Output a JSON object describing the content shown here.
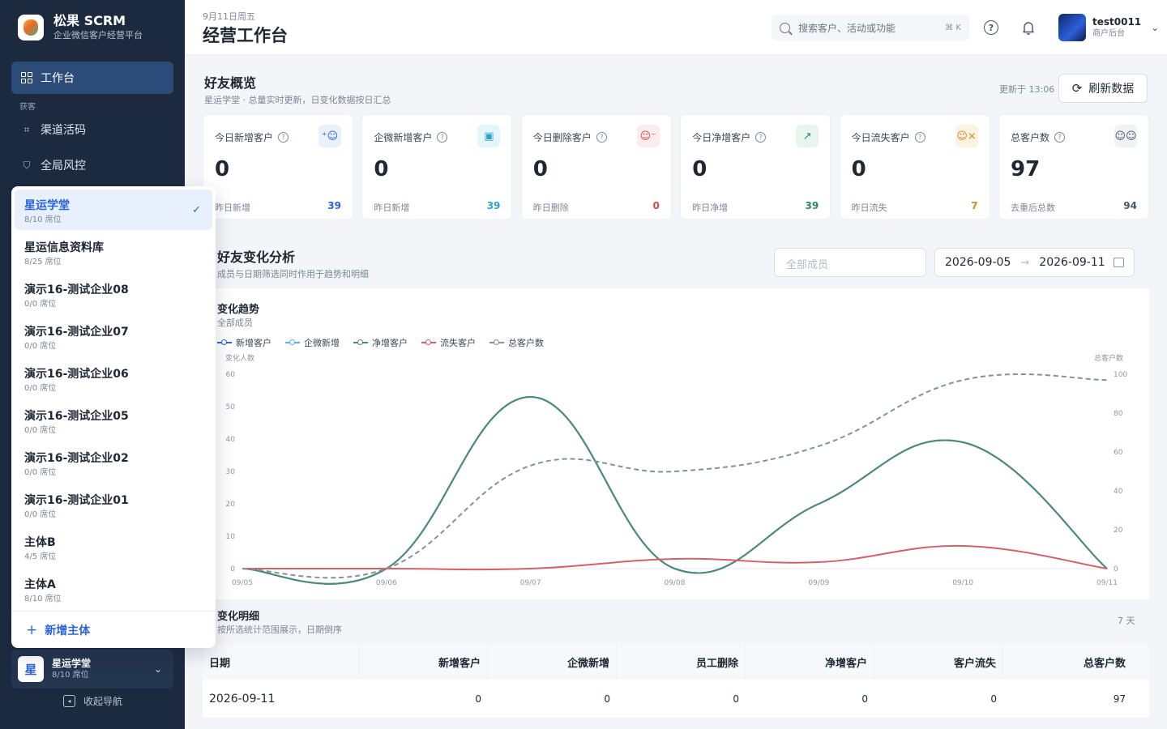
{
  "brand": {
    "title": "松果 SCRM",
    "subtitle": "企业微信客户经营平台"
  },
  "sidebar": {
    "active_item": "工作台",
    "group_label": "获客",
    "items": [
      {
        "label": "渠道活码",
        "icon": "qrcode-icon"
      },
      {
        "label": "全局风控",
        "icon": "shield-icon"
      }
    ],
    "current_org": {
      "avatar": "星",
      "name": "星运学堂",
      "seats": "8/10 席位"
    },
    "collapse_label": "收起导航"
  },
  "org_dropdown": {
    "items": [
      {
        "name": "星运学堂",
        "seats": "8/10 席位",
        "selected": true
      },
      {
        "name": "星运信息资料库",
        "seats": "8/25 席位"
      },
      {
        "name": "演示16-测试企业08",
        "seats": "0/0 席位"
      },
      {
        "name": "演示16-测试企业07",
        "seats": "0/0 席位"
      },
      {
        "name": "演示16-测试企业06",
        "seats": "0/0 席位"
      },
      {
        "name": "演示16-测试企业05",
        "seats": "0/0 席位"
      },
      {
        "name": "演示16-测试企业02",
        "seats": "0/0 席位"
      },
      {
        "name": "演示16-测试企业01",
        "seats": "0/0 席位"
      },
      {
        "name": "主体B",
        "seats": "4/5 席位"
      },
      {
        "name": "主体A",
        "seats": "8/10 席位"
      }
    ],
    "add_label": "新增主体"
  },
  "header": {
    "date": "9月11日周五",
    "title": "经营工作台",
    "search_placeholder": "搜索客户、活动或功能",
    "search_shortcut": "⌘ K",
    "user_name": "test0011",
    "user_role": "商户后台"
  },
  "overview": {
    "title": "好友概览",
    "subtitle": "星运学堂 · 总量实时更新，日变化数据按日汇总",
    "updated": "更新于 13:06",
    "refresh_label": "刷新数据",
    "cards": [
      {
        "label": "今日新增客户",
        "value": "0",
        "foot_label": "昨日新增",
        "foot_value": "39",
        "icon": "user-plus-icon",
        "color": "#2b63d9",
        "bg": "#eaf1fd"
      },
      {
        "label": "企微新增客户",
        "value": "0",
        "foot_label": "昨日新增",
        "foot_value": "39",
        "icon": "contact-card-icon",
        "color": "#2aa3c8",
        "bg": "#e6f5fa"
      },
      {
        "label": "今日删除客户",
        "value": "0",
        "foot_label": "昨日删除",
        "foot_value": "0",
        "icon": "user-minus-icon",
        "color": "#d24a4a",
        "bg": "#fdecec"
      },
      {
        "label": "今日净增客户",
        "value": "0",
        "foot_label": "昨日净增",
        "foot_value": "39",
        "icon": "trend-up-icon",
        "color": "#2f8a5b",
        "bg": "#e7f5ee"
      },
      {
        "label": "今日流失客户",
        "value": "0",
        "foot_label": "昨日流失",
        "foot_value": "7",
        "icon": "user-x-icon",
        "color": "#d98a1c",
        "bg": "#fdf3e4"
      },
      {
        "label": "总客户数",
        "value": "97",
        "foot_label": "去重后总数",
        "foot_value": "94",
        "icon": "users-icon",
        "color": "#4a5566",
        "bg": "#f0f2f5"
      }
    ]
  },
  "analysis": {
    "title": "好友变化分析",
    "subtitle": "成员与日期筛选同时作用于趋势和明细",
    "member_placeholder": "全部成员",
    "date_start": "2026-09-05",
    "date_arrow": "→",
    "date_end": "2026-09-11"
  },
  "chart_data": {
    "type": "line",
    "title": "变化趋势",
    "subtitle": "全部成员",
    "ylabel": "变化人数",
    "y2label": "总客户数",
    "x": [
      "09/05",
      "09/06",
      "09/07",
      "09/08",
      "09/09",
      "09/10",
      "09/11"
    ],
    "ylim": [
      0,
      60
    ],
    "yticks": [
      0,
      10,
      20,
      30,
      40,
      50,
      60
    ],
    "y2lim": [
      0,
      100
    ],
    "y2ticks": [
      0,
      20,
      40,
      60,
      80,
      100
    ],
    "legend": [
      "新增客户",
      "企微新增",
      "净增客户",
      "流失客户",
      "总客户数"
    ],
    "series": [
      {
        "name": "新增客户",
        "axis": "left",
        "color": "#2b63d9",
        "values": [
          0,
          0,
          53,
          0,
          20,
          39,
          0
        ]
      },
      {
        "name": "企微新增",
        "axis": "left",
        "color": "#5ab4e0",
        "values": [
          0,
          0,
          53,
          0,
          20,
          39,
          0
        ]
      },
      {
        "name": "净增客户",
        "axis": "left",
        "color": "#4e8a6e",
        "values": [
          0,
          0,
          53,
          0,
          20,
          39,
          0
        ]
      },
      {
        "name": "流失客户",
        "axis": "left",
        "color": "#d2606a",
        "values": [
          0,
          0,
          0,
          3,
          2,
          7,
          0
        ]
      },
      {
        "name": "总客户数",
        "axis": "right",
        "color": "#8a9099",
        "dashed": true,
        "values": [
          0,
          0,
          53,
          50,
          63,
          97,
          97
        ]
      }
    ]
  },
  "detail": {
    "title": "变化明细",
    "subtitle": "按所选统计范围展示，日期倒序",
    "days": "7 天",
    "columns": [
      "日期",
      "新增客户",
      "企微新增",
      "员工删除",
      "净增客户",
      "客户流失",
      "总客户数"
    ],
    "rows": [
      [
        "2026-09-11",
        "0",
        "0",
        "0",
        "0",
        "0",
        "97"
      ]
    ]
  }
}
